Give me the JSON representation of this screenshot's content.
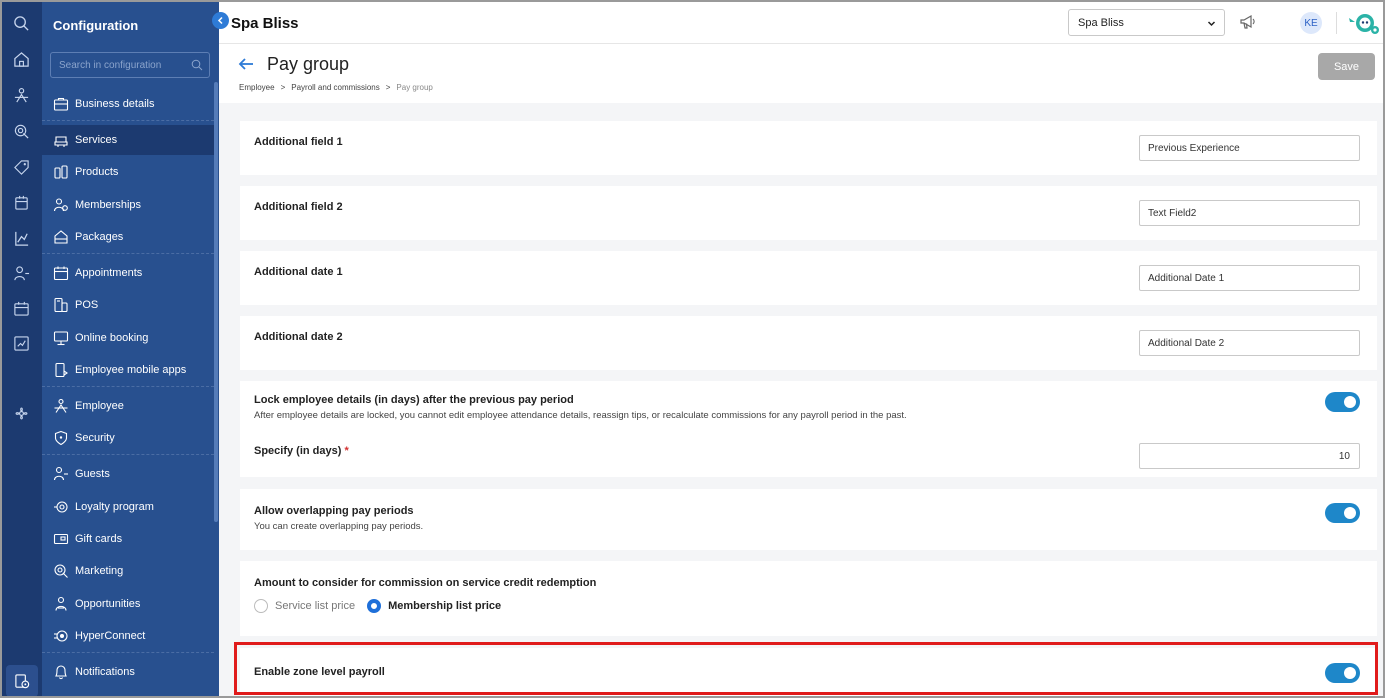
{
  "sidebar": {
    "title": "Configuration",
    "search_placeholder": "Search in configuration",
    "items": [
      {
        "label": "Business details",
        "icon": "briefcase-icon"
      },
      {
        "label": "Services",
        "icon": "services-icon"
      },
      {
        "label": "Products",
        "icon": "products-icon"
      },
      {
        "label": "Memberships",
        "icon": "memberships-icon"
      },
      {
        "label": "Packages",
        "icon": "packages-icon"
      },
      {
        "label": "Appointments",
        "icon": "calendar-icon"
      },
      {
        "label": "POS",
        "icon": "pos-icon"
      },
      {
        "label": "Online booking",
        "icon": "monitor-icon"
      },
      {
        "label": "Employee mobile apps",
        "icon": "mobile-icon"
      },
      {
        "label": "Employee",
        "icon": "employee-icon"
      },
      {
        "label": "Security",
        "icon": "shield-icon"
      },
      {
        "label": "Guests",
        "icon": "guests-icon"
      },
      {
        "label": "Loyalty program",
        "icon": "loyalty-icon"
      },
      {
        "label": "Gift cards",
        "icon": "gift-card-icon"
      },
      {
        "label": "Marketing",
        "icon": "marketing-icon"
      },
      {
        "label": "Opportunities",
        "icon": "opportunities-icon"
      },
      {
        "label": "HyperConnect",
        "icon": "hyperconnect-icon"
      },
      {
        "label": "Notifications",
        "icon": "bell-icon"
      }
    ]
  },
  "topbar": {
    "brand": "Spa Bliss",
    "location": "Spa Bliss",
    "avatar_initials": "KE"
  },
  "header": {
    "title": "Pay group",
    "breadcrumb": [
      "Employee",
      ">",
      "Payroll and commissions",
      ">",
      "Pay group"
    ],
    "save_label": "Save"
  },
  "form": {
    "additional_field_1": {
      "label": "Additional field 1",
      "value": "Previous Experience"
    },
    "additional_field_2": {
      "label": "Additional field 2",
      "value": "Text Field2"
    },
    "additional_date_1": {
      "label": "Additional date 1",
      "value": "Additional Date 1"
    },
    "additional_date_2": {
      "label": "Additional date 2",
      "value": "Additional Date 2"
    },
    "lock_details": {
      "label": "Lock employee details (in days) after the previous pay period",
      "description": "After employee details are locked, you cannot edit employee attendance details, reassign tips, or recalculate commissions for any payroll period in the past.",
      "enabled": true,
      "days_label": "Specify (in days)",
      "required_mark": "*",
      "days_value": "10"
    },
    "overlapping": {
      "label": "Allow overlapping pay periods",
      "description": "You can create overlapping pay periods.",
      "enabled": true
    },
    "commission_amount": {
      "label": "Amount to consider for commission on service credit redemption",
      "options": [
        "Service list price",
        "Membership list price"
      ],
      "selected": "Membership list price"
    },
    "zone_payroll": {
      "label": "Enable zone level payroll",
      "enabled": true
    }
  },
  "colors": {
    "rail": "#1c3a70",
    "sidebar": "#28508f",
    "toggle_on": "#1e87c9",
    "highlight": "#e01b1b"
  }
}
